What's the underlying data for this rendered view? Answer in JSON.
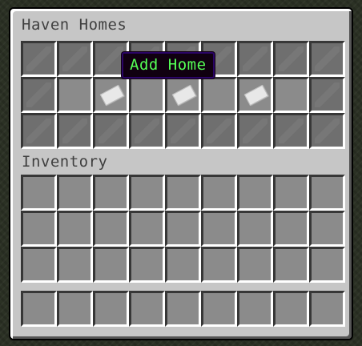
{
  "container": {
    "title": "Haven Homes",
    "rows": [
      [
        "filler",
        "filler",
        "filler",
        "filler",
        "filler",
        "filler",
        "filler",
        "filler",
        "filler"
      ],
      [
        "filler",
        "empty",
        "home",
        "empty",
        "home",
        "empty",
        "home",
        "empty",
        "filler"
      ],
      [
        "filler",
        "filler",
        "filler",
        "filler",
        "filler",
        "filler",
        "filler",
        "filler",
        "filler"
      ]
    ]
  },
  "inventory": {
    "title": "Inventory",
    "main_rows": 3,
    "hotbar_slots": 9
  },
  "tooltip": {
    "text": "Add Home",
    "color": "#55ff55"
  },
  "icons": {
    "filler": "gray-glass-pane-icon",
    "home": "paper-icon"
  }
}
